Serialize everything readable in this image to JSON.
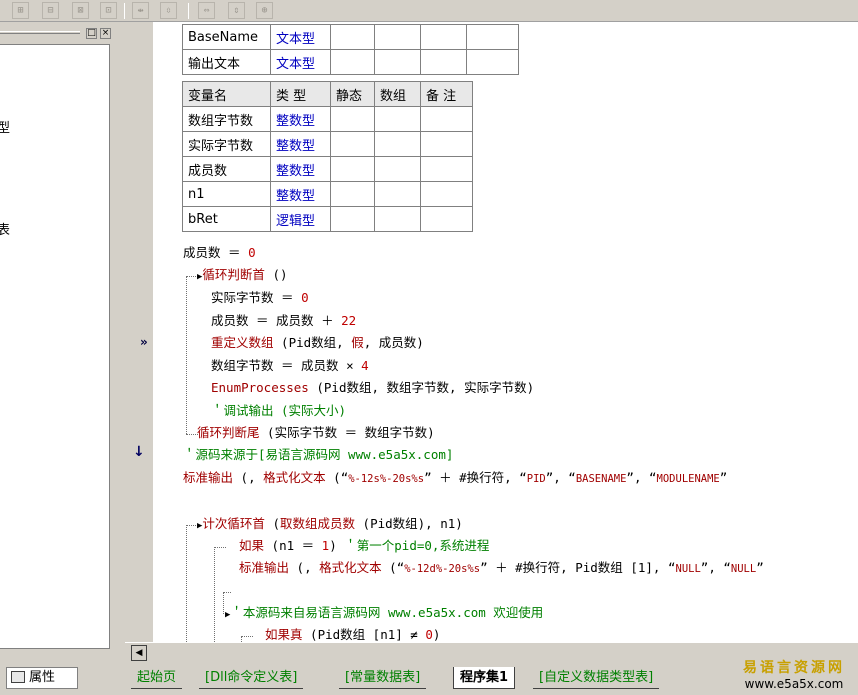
{
  "toolbar": {
    "buttons": [
      "⊞",
      "⊟",
      "⊠",
      "⊡",
      "⇹",
      "⇳",
      "⇔",
      "⇕",
      "⊕"
    ]
  },
  "left_panel": {
    "fragments": [
      "型",
      "表"
    ],
    "property_tab": "属性"
  },
  "table1": {
    "rows": [
      {
        "name": "BaseName",
        "type": "文本型"
      },
      {
        "name": "输出文本",
        "type": "文本型"
      }
    ]
  },
  "table2": {
    "headers": [
      "变量名",
      "类 型",
      "静态",
      "数组",
      "备 注"
    ],
    "rows": [
      {
        "name": "数组字节数",
        "type": "整数型"
      },
      {
        "name": "实际字节数",
        "type": "整数型"
      },
      {
        "name": "成员数",
        "type": "整数型"
      },
      {
        "name": "n1",
        "type": "整数型"
      },
      {
        "name": "bRet",
        "type": "逻辑型"
      }
    ]
  },
  "code": {
    "l1": "成员数 ＝ ",
    "l1n": "0",
    "l2": "循环判断首",
    "l2b": " ()",
    "l3": "实际字节数 ＝ ",
    "l3n": "0",
    "l4": "成员数 ＝ 成员数 ＋ ",
    "l4n": "22",
    "l5k": "重定义数组",
    "l5": " (Pid数组, ",
    "l5b": "假",
    "l5c": ", 成员数)",
    "l6": "数组字节数 ＝ 成员数 × ",
    "l6n": "4",
    "l7k": "EnumProcesses",
    "l7": " (Pid数组, 数组字节数, 实际字节数)",
    "l8": "＇调试输出 (实际大小)",
    "l9k": "循环判断尾",
    "l9": " (实际字节数 ＝ 数组字节数)",
    "l10": "＇源码来源于[易语言源码网 www.e5a5x.com]",
    "l11k": "标准输出",
    "l11": " (, ",
    "l11k2": "格式化文本",
    "l11b": " (“",
    "l11s": "%-12s%-20s%s",
    "l11c": "” ＋ #换行符, “",
    "l11s2": "PID",
    "l11d": "”, “",
    "l11s3": "BASENAME",
    "l11e": "”, “",
    "l11s4": "MODULENAME",
    "l11f": "”",
    "l12k": "计次循环首",
    "l12": " (",
    "l12k2": "取数组成员数",
    "l12b": " (Pid数组), n1)",
    "l13k": "如果",
    "l13": " (n1 ＝ ",
    "l13n": "1",
    "l13b": ") ",
    "l13c": "＇第一个pid=0,系统进程",
    "l14k": "标准输出",
    "l14": " (, ",
    "l14k2": "格式化文本",
    "l14b": " (“",
    "l14s": "%-12d%-20s%s",
    "l14c": "” ＋ #换行符, Pid数组 [1], “",
    "l14s2": "NULL",
    "l14d": "”, “",
    "l14s3": "NULL",
    "l14e": "”",
    "l15": "＇本源码来自易语言源码网 www.e5a5x.com  欢迎使用",
    "l16k": "如果真",
    "l16": " (Pid数组 [n1] ≠ ",
    "l16n": "0",
    "l16b": ")"
  },
  "gutter": {
    "marker1": "»",
    "marker2": "↓"
  },
  "tabs": [
    "起始页",
    "[Dll命令定义表]",
    "[常量数据表]",
    "程序集1",
    "[自定义数据类型表]"
  ],
  "active_tab": "程序集1",
  "logo": {
    "line1": "易语言资源网",
    "line2": "www.e5a5x.com"
  },
  "colors": {
    "keyword": "#a00000",
    "comment": "#008000",
    "type": "#0000c0"
  }
}
